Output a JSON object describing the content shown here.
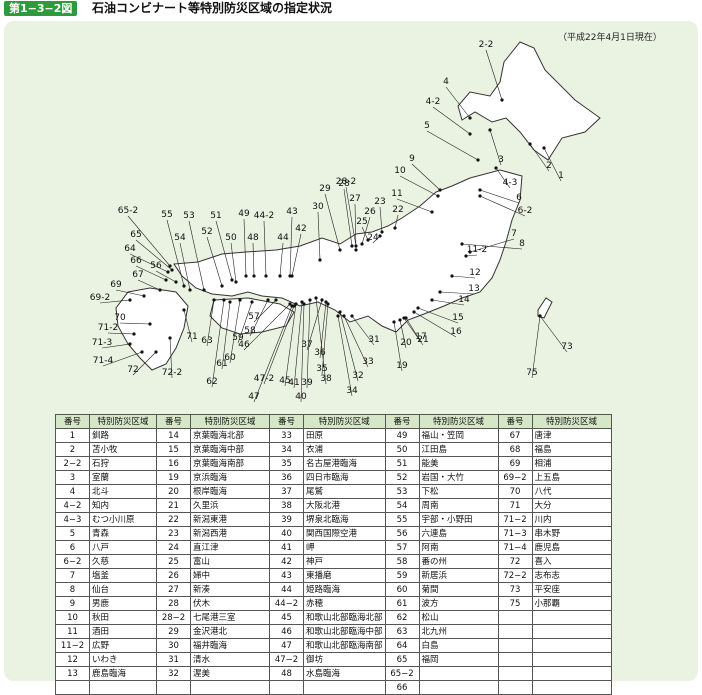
{
  "header": {
    "figure_label": "第1−3−2図",
    "title": "石油コンビナート等特別防災区域の指定状況"
  },
  "date_note": "（平成22年4月1日現在）",
  "map": {
    "region_fill": "#ffffff",
    "region_stroke": "#333333",
    "point_color": "#111111",
    "labels": [
      "1",
      "2",
      "2-2",
      "3",
      "4",
      "4-2",
      "4-3",
      "5",
      "6",
      "6-2",
      "7",
      "8",
      "9",
      "10",
      "11",
      "11-2",
      "12",
      "13",
      "14",
      "15",
      "16",
      "17",
      "19",
      "20",
      "21",
      "22",
      "23",
      "24",
      "25",
      "26",
      "27",
      "28",
      "28-2",
      "29",
      "30",
      "31",
      "32",
      "33",
      "34",
      "35",
      "36",
      "37",
      "38",
      "39",
      "40",
      "41",
      "42",
      "43",
      "44",
      "44-2",
      "45",
      "46",
      "47",
      "47-2",
      "48",
      "49",
      "50",
      "51",
      "52",
      "53",
      "54",
      "55",
      "56",
      "57",
      "58",
      "59",
      "60",
      "61",
      "62",
      "63",
      "64",
      "65",
      "65-2",
      "66",
      "67",
      "69",
      "69-2",
      "70",
      "71",
      "71-2",
      "71-3",
      "71-4",
      "72",
      "72-2",
      "73",
      "75"
    ]
  },
  "table": {
    "header_no": "番号",
    "header_name": "特別防災区域",
    "rows": [
      [
        "1",
        "釧路",
        "14",
        "京葉臨海北部",
        "33",
        "田原",
        "49",
        "福山・笠岡",
        "67",
        "唐津"
      ],
      [
        "2",
        "苫小牧",
        "15",
        "京葉臨海中部",
        "34",
        "衣浦",
        "50",
        "江田島",
        "68",
        "福島"
      ],
      [
        "2−2",
        "石狩",
        "16",
        "京葉臨海南部",
        "35",
        "名古屋港臨海",
        "51",
        "能美",
        "69",
        "相浦"
      ],
      [
        "3",
        "室蘭",
        "19",
        "京浜臨海",
        "36",
        "四日市臨海",
        "52",
        "岩国・大竹",
        "69−2",
        "上五島"
      ],
      [
        "4",
        "北斗",
        "20",
        "根岸臨海",
        "37",
        "尾鷲",
        "53",
        "下松",
        "70",
        "八代"
      ],
      [
        "4−2",
        "知内",
        "21",
        "久里浜",
        "38",
        "大阪北港",
        "54",
        "周南",
        "71",
        "大分"
      ],
      [
        "4−3",
        "むつ小川原",
        "22",
        "新潟東港",
        "39",
        "堺泉北臨海",
        "55",
        "宇部・小野田",
        "71−2",
        "川内"
      ],
      [
        "5",
        "青森",
        "23",
        "新潟西港",
        "40",
        "関西国際空港",
        "56",
        "六連島",
        "71−3",
        "串木野"
      ],
      [
        "6",
        "八戸",
        "24",
        "直江津",
        "41",
        "岬",
        "57",
        "阿南",
        "71−4",
        "鹿児島"
      ],
      [
        "6−2",
        "久慈",
        "25",
        "富山",
        "42",
        "神戸",
        "58",
        "番の州",
        "72",
        "喜入"
      ],
      [
        "7",
        "塩釜",
        "26",
        "婦中",
        "43",
        "東播磨",
        "59",
        "新居浜",
        "72−2",
        "志布志"
      ],
      [
        "8",
        "仙台",
        "27",
        "新湊",
        "44",
        "姫路臨海",
        "60",
        "菊間",
        "73",
        "平安座"
      ],
      [
        "9",
        "男鹿",
        "28",
        "伏木",
        "44−2",
        "赤穂",
        "61",
        "波方",
        "75",
        "小那覇"
      ],
      [
        "10",
        "秋田",
        "28−2",
        "七尾港三室",
        "45",
        "和歌山北部臨海北部",
        "62",
        "松山",
        "",
        ""
      ],
      [
        "11",
        "酒田",
        "29",
        "金沢港北",
        "46",
        "和歌山北部臨海中部",
        "63",
        "北九州",
        "",
        ""
      ],
      [
        "11−2",
        "広野",
        "30",
        "福井臨海",
        "47",
        "和歌山北部臨海南部",
        "64",
        "白島",
        "",
        ""
      ],
      [
        "12",
        "いわき",
        "31",
        "清水",
        "47−2",
        "御坊",
        "65",
        "福岡",
        "",
        ""
      ],
      [
        "13",
        "鹿島臨海",
        "32",
        "渥美",
        "48",
        "水島臨海",
        "65−2",
        "",
        "",
        ""
      ],
      [
        "",
        "",
        "",
        "",
        "",
        "",
        "66",
        "",
        "",
        ""
      ]
    ]
  }
}
